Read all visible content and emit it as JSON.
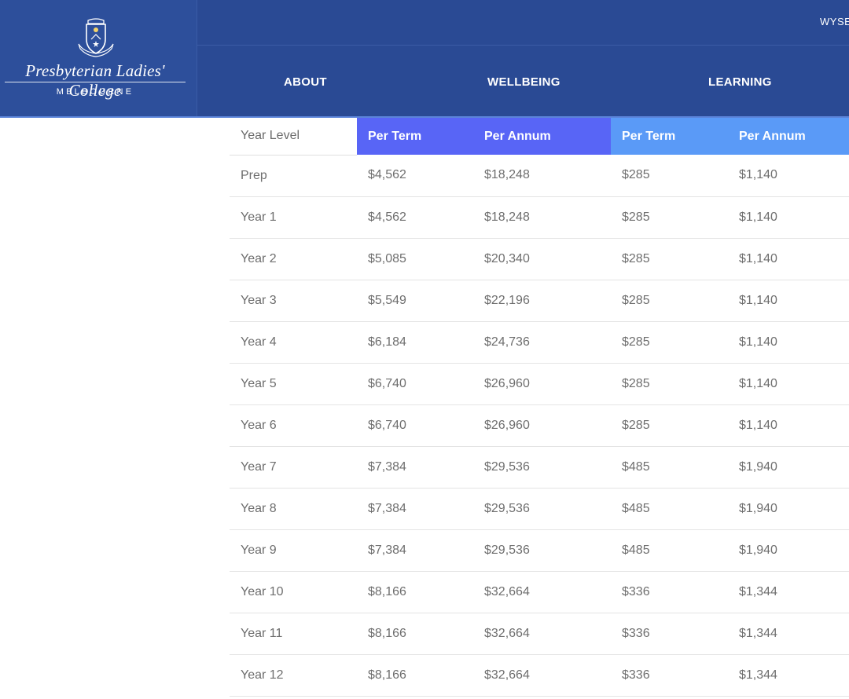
{
  "header": {
    "logo_name": "Presbyterian Ladies' College",
    "logo_subtitle": "MELBOURNE",
    "utility_link": "WYSE",
    "nav": [
      "ABOUT",
      "WELLBEING",
      "LEARNING"
    ]
  },
  "table": {
    "columns": [
      "Year Level",
      "Per Term",
      "Per Annum",
      "Per Term",
      "Per Annum"
    ],
    "rows": [
      [
        "Prep",
        "$4,562",
        "$18,248",
        "$285",
        "$1,140"
      ],
      [
        "Year 1",
        "$4,562",
        "$18,248",
        "$285",
        "$1,140"
      ],
      [
        "Year 2",
        "$5,085",
        "$20,340",
        "$285",
        "$1,140"
      ],
      [
        "Year 3",
        "$5,549",
        "$22,196",
        "$285",
        "$1,140"
      ],
      [
        "Year 4",
        "$6,184",
        "$24,736",
        "$285",
        "$1,140"
      ],
      [
        "Year 5",
        "$6,740",
        "$26,960",
        "$285",
        "$1,140"
      ],
      [
        "Year 6",
        "$6,740",
        "$26,960",
        "$285",
        "$1,140"
      ],
      [
        "Year 7",
        "$7,384",
        "$29,536",
        "$485",
        "$1,940"
      ],
      [
        "Year 8",
        "$7,384",
        "$29,536",
        "$485",
        "$1,940"
      ],
      [
        "Year 9",
        "$7,384",
        "$29,536",
        "$485",
        "$1,940"
      ],
      [
        "Year 10",
        "$8,166",
        "$32,664",
        "$336",
        "$1,344"
      ],
      [
        "Year 11",
        "$8,166",
        "$32,664",
        "$336",
        "$1,344"
      ],
      [
        "Year 12",
        "$8,166",
        "$32,664",
        "$336",
        "$1,344"
      ]
    ]
  },
  "colors": {
    "header_bg": "#2a4a94",
    "tuition_header": "#5865f6",
    "levy_header": "#5a9af7"
  },
  "icons": {
    "crest": "school-crest-icon"
  }
}
